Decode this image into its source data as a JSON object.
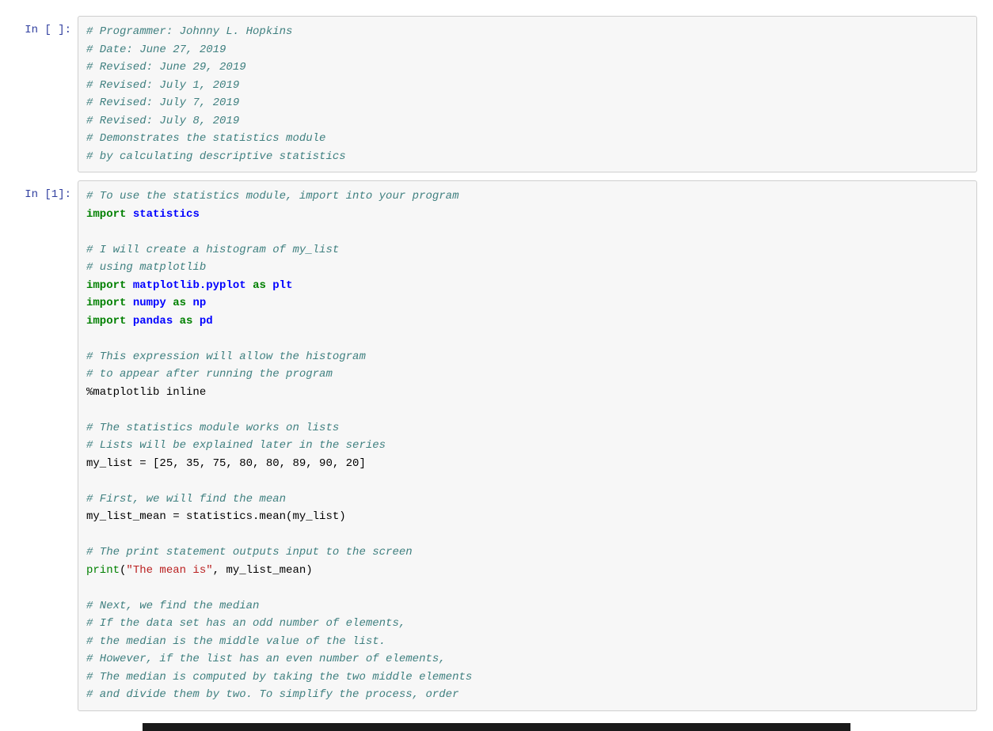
{
  "cells": [
    {
      "prompt": "In [ ]:",
      "lines": [
        {
          "class": "cm",
          "text": "# Programmer: Johnny L. Hopkins"
        },
        {
          "class": "cm",
          "text": "# Date: June 27, 2019"
        },
        {
          "class": "cm",
          "text": "# Revised: June 29, 2019"
        },
        {
          "class": "cm",
          "text": "# Revised: July 1, 2019"
        },
        {
          "class": "cm",
          "text": "# Revised: July 7, 2019"
        },
        {
          "class": "cm",
          "text": "# Revised: July 8, 2019"
        },
        {
          "class": "cm",
          "text": "# Demonstrates the statistics module"
        },
        {
          "class": "cm",
          "text": "# by calculating descriptive statistics"
        }
      ]
    },
    {
      "prompt": "In [1]:",
      "lines": [
        {
          "class": "cm",
          "text": "# To use the statistics module, import into your program"
        },
        {
          "segments": [
            {
              "c": "kw",
              "t": "import"
            },
            {
              "c": "plain",
              "t": " "
            },
            {
              "c": "nm",
              "t": "statistics"
            }
          ]
        },
        {
          "class": "plain",
          "text": ""
        },
        {
          "class": "cm",
          "text": "# I will create a histogram of my_list"
        },
        {
          "class": "cm",
          "text": "# using matplotlib"
        },
        {
          "segments": [
            {
              "c": "kw",
              "t": "import"
            },
            {
              "c": "plain",
              "t": " "
            },
            {
              "c": "nm",
              "t": "matplotlib.pyplot"
            },
            {
              "c": "plain",
              "t": " "
            },
            {
              "c": "kw",
              "t": "as"
            },
            {
              "c": "plain",
              "t": " "
            },
            {
              "c": "nm",
              "t": "plt"
            }
          ]
        },
        {
          "segments": [
            {
              "c": "kw",
              "t": "import"
            },
            {
              "c": "plain",
              "t": " "
            },
            {
              "c": "nm",
              "t": "numpy"
            },
            {
              "c": "plain",
              "t": " "
            },
            {
              "c": "kw",
              "t": "as"
            },
            {
              "c": "plain",
              "t": " "
            },
            {
              "c": "nm",
              "t": "np"
            }
          ]
        },
        {
          "segments": [
            {
              "c": "kw",
              "t": "import"
            },
            {
              "c": "plain",
              "t": " "
            },
            {
              "c": "nm",
              "t": "pandas"
            },
            {
              "c": "plain",
              "t": " "
            },
            {
              "c": "kw",
              "t": "as"
            },
            {
              "c": "plain",
              "t": " "
            },
            {
              "c": "nm",
              "t": "pd"
            }
          ]
        },
        {
          "class": "plain",
          "text": ""
        },
        {
          "class": "cm",
          "text": "# This expression will allow the histogram"
        },
        {
          "class": "cm",
          "text": "# to appear after running the program"
        },
        {
          "segments": [
            {
              "c": "plain",
              "t": "%matplotlib inline"
            }
          ]
        },
        {
          "class": "plain",
          "text": ""
        },
        {
          "class": "cm",
          "text": "# The statistics module works on lists"
        },
        {
          "class": "cm",
          "text": "# Lists will be explained later in the series"
        },
        {
          "segments": [
            {
              "c": "plain",
              "t": "my_list = [25, 35, 75, 80, 80, 89, 90, 20]"
            }
          ]
        },
        {
          "class": "plain",
          "text": ""
        },
        {
          "class": "cm",
          "text": "# First, we will find the mean"
        },
        {
          "segments": [
            {
              "c": "plain",
              "t": "my_list_mean = statistics.mean(my_list)"
            }
          ]
        },
        {
          "class": "plain",
          "text": ""
        },
        {
          "class": "cm",
          "text": "# The print statement outputs input to the screen"
        },
        {
          "segments": [
            {
              "c": "fn",
              "t": "print"
            },
            {
              "c": "plain",
              "t": "("
            },
            {
              "c": "st",
              "t": "\"The mean is\""
            },
            {
              "c": "plain",
              "t": ", my_list_mean)"
            }
          ]
        },
        {
          "class": "plain",
          "text": ""
        },
        {
          "class": "cm",
          "text": "# Next, we find the median"
        },
        {
          "class": "cm",
          "text": "# If the data set has an odd number of elements,"
        },
        {
          "class": "cm",
          "text": "# the median is the middle value of the list."
        },
        {
          "class": "cm",
          "text": "# However, if the list has an even number of elements,"
        },
        {
          "class": "cm",
          "text": "# The median is computed by taking the two middle elements"
        },
        {
          "class": "cm",
          "text": "# and divide them by two. To simplify the process, order"
        }
      ]
    }
  ]
}
